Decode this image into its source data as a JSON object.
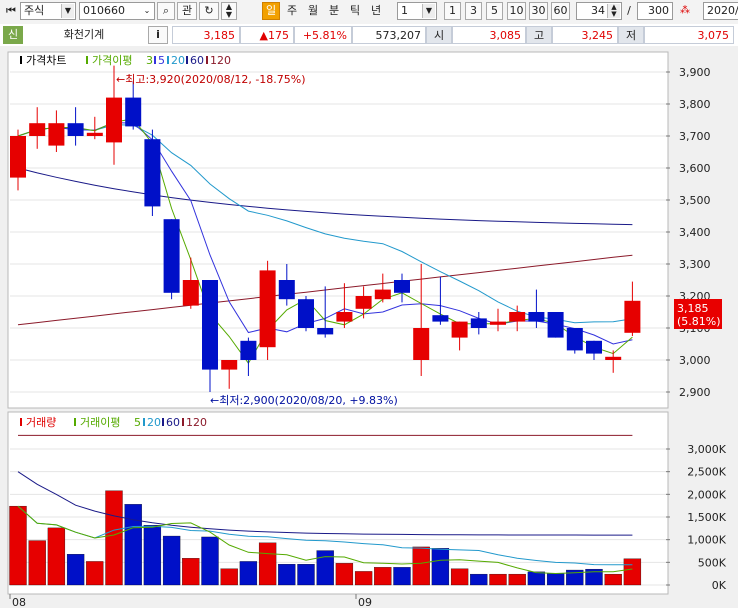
{
  "toolbar": {
    "market": "주식",
    "code": "010660",
    "btn_gwan": "관",
    "btn_il": "일",
    "periods": [
      "주",
      "월",
      "분",
      "틱",
      "년"
    ],
    "multiplier": "1",
    "quick": [
      "1",
      "3",
      "5",
      "10",
      "30",
      "60"
    ],
    "count": "34",
    "slash": "/",
    "total": "300",
    "date": "2020/0"
  },
  "info": {
    "tag": "신",
    "name": "화천기계",
    "i": "i",
    "price": "3,185",
    "change": "▲175",
    "rate": "+5.81%",
    "volume": "573,207",
    "open_label": "시",
    "open": "3,085",
    "high_label": "고",
    "high": "3,245",
    "low_label": "저",
    "low": "3,075"
  },
  "price_panel": {
    "legend_title": "가격차트",
    "legend_ma": "가격이평",
    "legend_periods": [
      "3",
      "5",
      "20",
      "60",
      "120"
    ],
    "high_annotation": "←최고:3,920(2020/08/12, -18.75%)",
    "low_annotation": "←최저:2,900(2020/08/20, +9.83%)",
    "price_badge": "3,185",
    "rate_badge": "(5.81%)",
    "y_ticks": [
      "3,900",
      "3,800",
      "3,700",
      "3,600",
      "3,500",
      "3,400",
      "3,300",
      "3,200",
      "3,100",
      "3,000",
      "2,900"
    ]
  },
  "volume_panel": {
    "legend_title": "거래량",
    "legend_ma": "거래이평",
    "legend_periods": [
      "5",
      "20",
      "60",
      "120"
    ],
    "y_ticks": [
      "3,000K",
      "2,500K",
      "2,000K",
      "1,500K",
      "1,000K",
      "500K",
      "0K"
    ]
  },
  "x_ticks": [
    "08",
    "09"
  ],
  "colors": {
    "up": "#e60000",
    "down": "#0010c8",
    "ma3": "#55aa00",
    "ma5": "#3333dd",
    "ma20": "#2299cc",
    "ma60": "#1a1a88",
    "ma120": "#8b1a2a"
  },
  "chart_data": {
    "type": "candlestick",
    "ylim": [
      2860,
      3960
    ],
    "candles": [
      {
        "o": 3570,
        "h": 3720,
        "l": 3530,
        "c": 3700
      },
      {
        "o": 3700,
        "h": 3790,
        "l": 3660,
        "c": 3740
      },
      {
        "o": 3670,
        "h": 3780,
        "l": 3650,
        "c": 3740
      },
      {
        "o": 3740,
        "h": 3790,
        "l": 3670,
        "c": 3700
      },
      {
        "o": 3700,
        "h": 3760,
        "l": 3690,
        "c": 3710
      },
      {
        "o": 3680,
        "h": 3920,
        "l": 3610,
        "c": 3820
      },
      {
        "o": 3820,
        "h": 3870,
        "l": 3720,
        "c": 3730
      },
      {
        "o": 3690,
        "h": 3720,
        "l": 3450,
        "c": 3480
      },
      {
        "o": 3440,
        "h": 3440,
        "l": 3190,
        "c": 3210
      },
      {
        "o": 3170,
        "h": 3320,
        "l": 3160,
        "c": 3250
      },
      {
        "o": 3250,
        "h": 3250,
        "l": 2900,
        "c": 2970
      },
      {
        "o": 2970,
        "h": 3000,
        "l": 2910,
        "c": 3000
      },
      {
        "o": 3060,
        "h": 3070,
        "l": 2950,
        "c": 3000
      },
      {
        "o": 3040,
        "h": 3310,
        "l": 3000,
        "c": 3280
      },
      {
        "o": 3250,
        "h": 3300,
        "l": 3170,
        "c": 3190
      },
      {
        "o": 3190,
        "h": 3200,
        "l": 3090,
        "c": 3100
      },
      {
        "o": 3100,
        "h": 3230,
        "l": 3070,
        "c": 3080
      },
      {
        "o": 3120,
        "h": 3240,
        "l": 3100,
        "c": 3150
      },
      {
        "o": 3160,
        "h": 3230,
        "l": 3130,
        "c": 3200
      },
      {
        "o": 3190,
        "h": 3270,
        "l": 3180,
        "c": 3220
      },
      {
        "o": 3250,
        "h": 3270,
        "l": 3180,
        "c": 3210
      },
      {
        "o": 3000,
        "h": 3300,
        "l": 2950,
        "c": 3100
      },
      {
        "o": 3140,
        "h": 3260,
        "l": 3110,
        "c": 3120
      },
      {
        "o": 3070,
        "h": 3120,
        "l": 3030,
        "c": 3120
      },
      {
        "o": 3130,
        "h": 3150,
        "l": 3080,
        "c": 3100
      },
      {
        "o": 3110,
        "h": 3160,
        "l": 3090,
        "c": 3120
      },
      {
        "o": 3120,
        "h": 3170,
        "l": 3090,
        "c": 3150
      },
      {
        "o": 3150,
        "h": 3220,
        "l": 3100,
        "c": 3120
      },
      {
        "o": 3150,
        "h": 3150,
        "l": 3070,
        "c": 3070
      },
      {
        "o": 3100,
        "h": 3100,
        "l": 3020,
        "c": 3030
      },
      {
        "o": 3060,
        "h": 3060,
        "l": 3000,
        "c": 3020
      },
      {
        "o": 3000,
        "h": 3030,
        "l": 2960,
        "c": 3010
      },
      {
        "o": 3085,
        "h": 3245,
        "l": 3075,
        "c": 3185
      }
    ],
    "volume": [
      1740,
      980,
      1260,
      680,
      520,
      2080,
      1780,
      1320,
      1080,
      590,
      1060,
      360,
      520,
      930,
      460,
      460,
      760,
      480,
      300,
      390,
      390,
      840,
      810,
      360,
      240,
      240,
      240,
      290,
      260,
      330,
      350,
      240,
      580
    ],
    "volume_ylim": [
      0,
      3300
    ]
  }
}
